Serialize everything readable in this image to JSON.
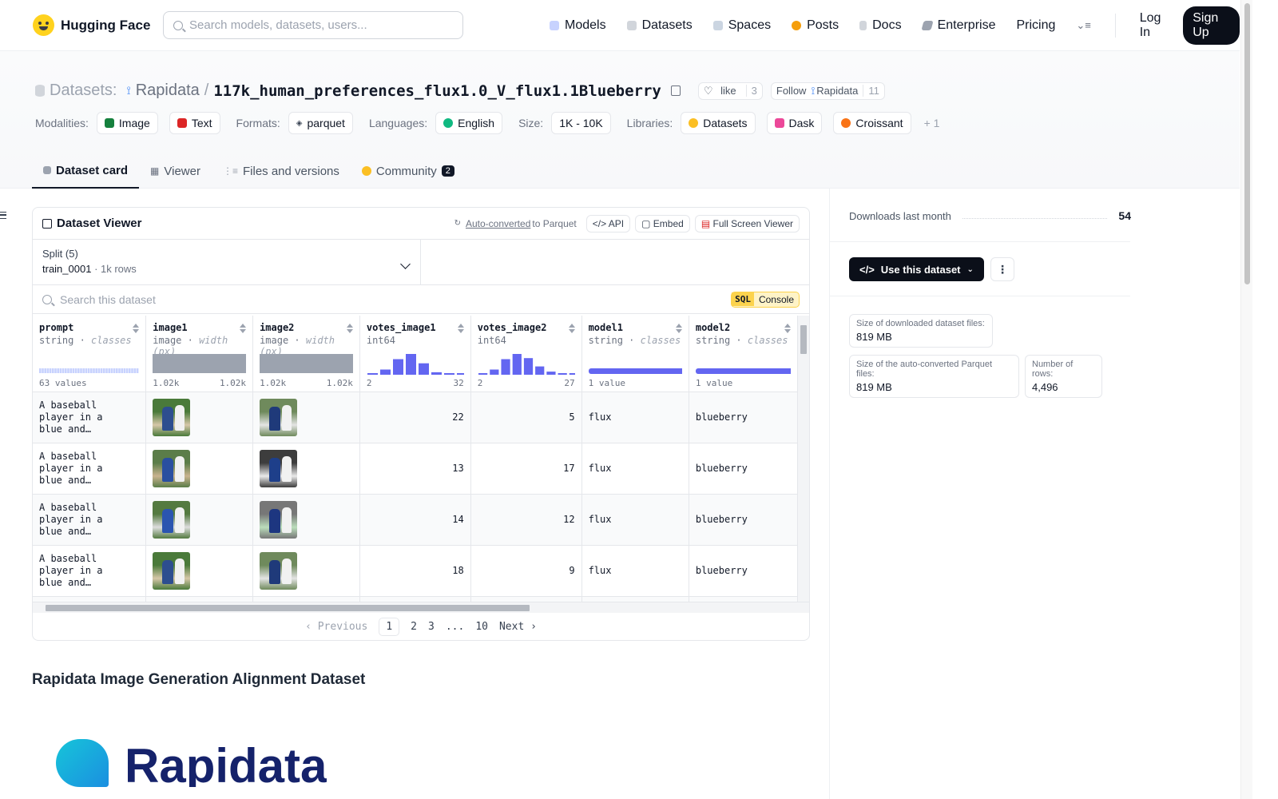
{
  "brand": "Hugging Face",
  "search": {
    "placeholder": "Search models, datasets, users..."
  },
  "nav": [
    {
      "label": "Models",
      "color": "#a5b4fc"
    },
    {
      "label": "Datasets",
      "color": "#d1d5db"
    },
    {
      "label": "Spaces",
      "color": "#9ca3af"
    },
    {
      "label": "Posts",
      "color": "#f59e0b"
    },
    {
      "label": "Docs",
      "color": "#9ca3af"
    },
    {
      "label": "Enterprise",
      "color": "#6b7280"
    },
    {
      "label": "Pricing"
    }
  ],
  "auth": {
    "login": "Log In",
    "signup": "Sign Up"
  },
  "header": {
    "section": "Datasets:",
    "org": "Rapidata",
    "sep": "/",
    "name": "117k_human_preferences_flux1.0_V_flux1.1Blueberry",
    "like": "like",
    "like_count": "3",
    "follow": "Follow",
    "follow_org": "Rapidata",
    "follow_count": "11",
    "meta": {
      "modalities_k": "Modalities:",
      "modalities": [
        "Image",
        "Text"
      ],
      "formats_k": "Formats:",
      "formats": [
        "parquet"
      ],
      "languages_k": "Languages:",
      "languages": [
        "English"
      ],
      "size_k": "Size:",
      "size": "1K - 10K",
      "libraries_k": "Libraries:",
      "libraries": [
        "Datasets",
        "Dask",
        "Croissant"
      ],
      "more": "+ 1"
    }
  },
  "tabs": [
    {
      "label": "Dataset card",
      "active": true
    },
    {
      "label": "Viewer"
    },
    {
      "label": "Files and versions"
    },
    {
      "label": "Community",
      "badge": "2"
    }
  ],
  "viewer": {
    "title": "Dataset Viewer",
    "auto": "Auto-converted",
    "to": "to Parquet",
    "api": "API",
    "embed": "Embed",
    "full": "Full Screen Viewer",
    "split_label": "Split (5)",
    "split_value": "train_0001",
    "split_rows": "1k rows",
    "search_placeholder": "Search this dataset",
    "sql": "SQL",
    "console": "Console",
    "columns": [
      {
        "name": "prompt",
        "type": "string",
        "sub": "classes",
        "left": "63 values",
        "right": ""
      },
      {
        "name": "image1",
        "type": "image",
        "sub": "width (px)",
        "left": "1.02k",
        "right": "1.02k"
      },
      {
        "name": "image2",
        "type": "image",
        "sub": "width (px)",
        "left": "1.02k",
        "right": "1.02k"
      },
      {
        "name": "votes_image1",
        "type": "int64",
        "sub": "",
        "left": "2",
        "right": "32"
      },
      {
        "name": "votes_image2",
        "type": "int64",
        "sub": "",
        "left": "2",
        "right": "27"
      },
      {
        "name": "model1",
        "type": "string",
        "sub": "classes",
        "left": "1 value",
        "right": ""
      },
      {
        "name": "model2",
        "type": "string",
        "sub": "classes",
        "left": "1 value",
        "right": ""
      }
    ],
    "hist_votes1": [
      0.05,
      0.25,
      0.75,
      1.0,
      0.55,
      0.12,
      0.05,
      0.04
    ],
    "hist_votes2": [
      0.05,
      0.25,
      0.75,
      1.0,
      0.8,
      0.4,
      0.15,
      0.05,
      0.04
    ],
    "rows": [
      {
        "prompt": "A baseball player in a blue and…",
        "votes_image1": "22",
        "votes_image2": "5",
        "model1": "flux",
        "model2": "blueberry"
      },
      {
        "prompt": "A baseball player in a blue and…",
        "votes_image1": "13",
        "votes_image2": "17",
        "model1": "flux",
        "model2": "blueberry"
      },
      {
        "prompt": "A baseball player in a blue and…",
        "votes_image1": "14",
        "votes_image2": "12",
        "model1": "flux",
        "model2": "blueberry"
      },
      {
        "prompt": "A baseball player in a blue and…",
        "votes_image1": "18",
        "votes_image2": "9",
        "model1": "flux",
        "model2": "blueberry"
      }
    ],
    "pager": {
      "prev": "Previous",
      "pages": [
        "1",
        "2",
        "3",
        "...",
        "10"
      ],
      "next": "Next"
    }
  },
  "card": {
    "heading": "Rapidata Image Generation Alignment Dataset",
    "logo_text": "Rapidata"
  },
  "sidebar": {
    "downloads_label": "Downloads last month",
    "downloads": "54",
    "use_button": "Use this dataset",
    "stats": [
      {
        "k": "Size of downloaded dataset files:",
        "v": "819 MB"
      },
      {
        "k": "Size of the auto-converted Parquet files:",
        "v": "819 MB"
      },
      {
        "k": "Number of rows:",
        "v": "4,496"
      }
    ]
  },
  "colors": {
    "accent": "#6366f1",
    "dark": "#0b0f19"
  }
}
